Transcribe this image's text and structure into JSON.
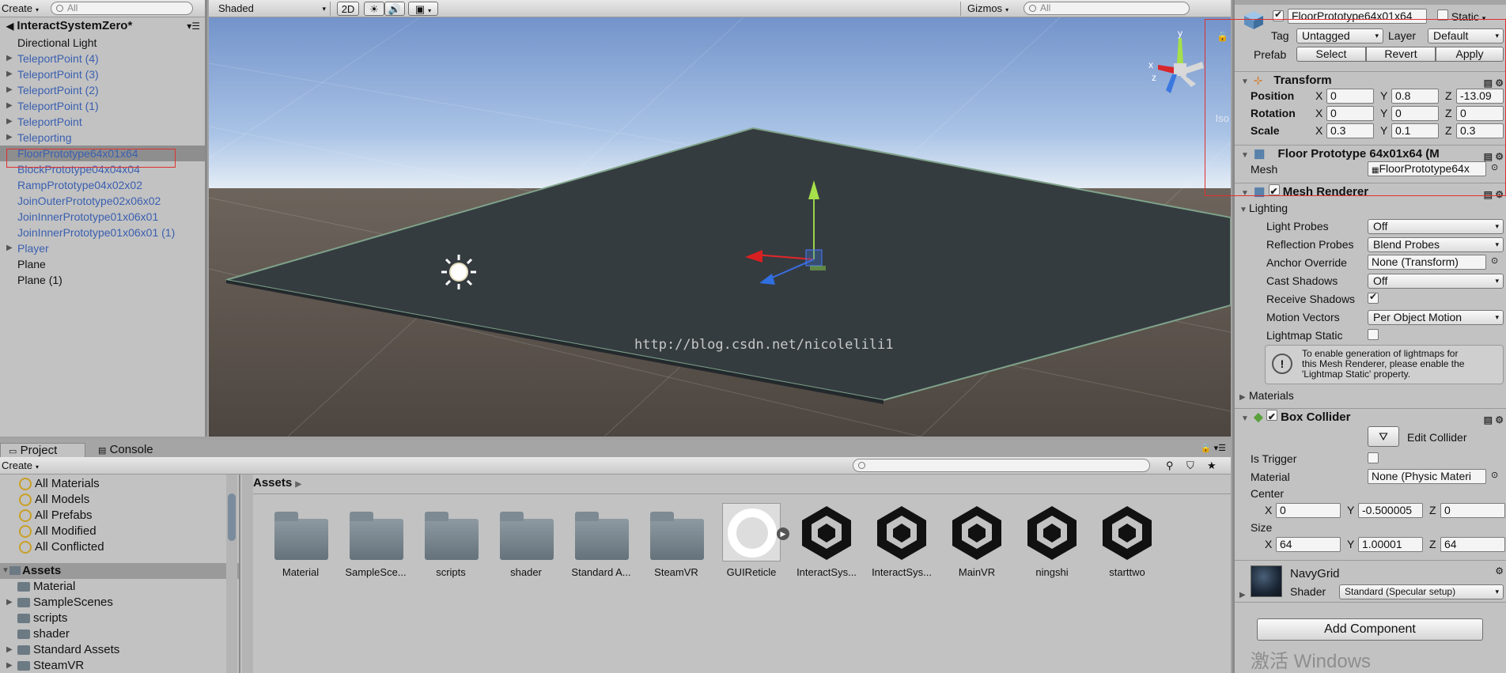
{
  "hierarchy": {
    "create_label": "Create",
    "search_placeholder": "All",
    "scene_name": "InteractSystemZero*",
    "items": [
      {
        "label": "Directional Light",
        "prefab": false,
        "expandable": false
      },
      {
        "label": "TeleportPoint (4)",
        "prefab": true,
        "expandable": true
      },
      {
        "label": "TeleportPoint (3)",
        "prefab": true,
        "expandable": true
      },
      {
        "label": "TeleportPoint (2)",
        "prefab": true,
        "expandable": true
      },
      {
        "label": "TeleportPoint (1)",
        "prefab": true,
        "expandable": true
      },
      {
        "label": "TeleportPoint",
        "prefab": true,
        "expandable": true
      },
      {
        "label": "Teleporting",
        "prefab": true,
        "expandable": true
      },
      {
        "label": "FloorPrototype64x01x64",
        "prefab": true,
        "expandable": false,
        "selected": true
      },
      {
        "label": "BlockPrototype04x04x04",
        "prefab": true,
        "expandable": false
      },
      {
        "label": "RampPrototype04x02x02",
        "prefab": true,
        "expandable": false
      },
      {
        "label": "JoinOuterPrototype02x06x02",
        "prefab": true,
        "expandable": false
      },
      {
        "label": "JoinInnerPrototype01x06x01",
        "prefab": true,
        "expandable": false
      },
      {
        "label": "JoinInnerPrototype01x06x01 (1)",
        "prefab": true,
        "expandable": false
      },
      {
        "label": "Player",
        "prefab": true,
        "expandable": true
      },
      {
        "label": "Plane",
        "prefab": false,
        "expandable": false
      },
      {
        "label": "Plane (1)",
        "prefab": false,
        "expandable": false
      }
    ]
  },
  "scene": {
    "shading_mode": "Shaded",
    "mode_2d": "2D",
    "gizmos_label": "Gizmos",
    "search_placeholder": "All",
    "persp_label": "Iso",
    "watermark": "http://blog.csdn.net/nicolelili1",
    "axis_y": "y",
    "axis_x": "x",
    "axis_z": "z"
  },
  "inspector": {
    "object_name": "FloorPrototype64x01x64",
    "active": true,
    "static_label": "Static",
    "tag_label": "Tag",
    "tag_value": "Untagged",
    "layer_label": "Layer",
    "layer_value": "Default",
    "prefab_label": "Prefab",
    "prefab_select": "Select",
    "prefab_revert": "Revert",
    "prefab_apply": "Apply",
    "transform": {
      "title": "Transform",
      "position_label": "Position",
      "rotation_label": "Rotation",
      "scale_label": "Scale",
      "position": {
        "x": "0",
        "y": "0.8",
        "z": "-13.09"
      },
      "rotation": {
        "x": "0",
        "y": "0",
        "z": "0"
      },
      "scale": {
        "x": "0.3",
        "y": "0.1",
        "z": "0.3"
      },
      "x": "X",
      "y": "Y",
      "z": "Z"
    },
    "mesh_filter": {
      "title": "Floor Prototype 64x01x64 (M",
      "mesh_label": "Mesh",
      "mesh_value": "FloorPrototype64x"
    },
    "mesh_renderer": {
      "title": "Mesh Renderer",
      "lighting_label": "Lighting",
      "light_probes_label": "Light Probes",
      "light_probes_value": "Off",
      "reflection_probes_label": "Reflection Probes",
      "reflection_probes_value": "Blend Probes",
      "anchor_override_label": "Anchor Override",
      "anchor_override_value": "None (Transform)",
      "cast_shadows_label": "Cast Shadows",
      "cast_shadows_value": "Off",
      "receive_shadows_label": "Receive Shadows",
      "motion_vectors_label": "Motion Vectors",
      "motion_vectors_value": "Per Object Motion",
      "lightmap_static_label": "Lightmap Static",
      "info_line1": "To enable generation of lightmaps for",
      "info_line2": "this Mesh Renderer, please enable the",
      "info_line3": "'Lightmap Static' property.",
      "materials_label": "Materials"
    },
    "box_collider": {
      "title": "Box Collider",
      "edit_collider_label": "Edit Collider",
      "is_trigger_label": "Is Trigger",
      "material_label": "Material",
      "material_value": "None (Physic Materi",
      "center_label": "Center",
      "center": {
        "x": "0",
        "y": "-0.500005",
        "z": "0"
      },
      "size_label": "Size",
      "size": {
        "x": "64",
        "y": "1.00001",
        "z": "64"
      }
    },
    "material": {
      "name": "NavyGrid",
      "shader_label": "Shader",
      "shader_value": "Standard (Specular setup)"
    },
    "add_component_label": "Add Component",
    "os_watermark": "激活 Windows"
  },
  "project": {
    "tab_project": "Project",
    "tab_console": "Console",
    "create_label": "Create",
    "favorites": [
      "All Materials",
      "All Models",
      "All Prefabs",
      "All Modified",
      "All Conflicted"
    ],
    "assets_root": "Assets",
    "tree": [
      {
        "label": "Material",
        "expandable": false
      },
      {
        "label": "SampleScenes",
        "expandable": true
      },
      {
        "label": "scripts",
        "expandable": false
      },
      {
        "label": "shader",
        "expandable": false
      },
      {
        "label": "Standard Assets",
        "expandable": true
      },
      {
        "label": "SteamVR",
        "expandable": true
      }
    ],
    "breadcrumb": "Assets",
    "assets": [
      {
        "name": "Material",
        "kind": "folder"
      },
      {
        "name": "SampleSce...",
        "kind": "folder"
      },
      {
        "name": "scripts",
        "kind": "folder"
      },
      {
        "name": "shader",
        "kind": "folder"
      },
      {
        "name": "Standard A...",
        "kind": "folder"
      },
      {
        "name": "SteamVR",
        "kind": "folder"
      },
      {
        "name": "GUIReticle",
        "kind": "texture"
      },
      {
        "name": "InteractSys...",
        "kind": "unity"
      },
      {
        "name": "InteractSys...",
        "kind": "unity"
      },
      {
        "name": "MainVR",
        "kind": "unity"
      },
      {
        "name": "ningshi",
        "kind": "unity"
      },
      {
        "name": "starttwo",
        "kind": "unity"
      }
    ]
  }
}
